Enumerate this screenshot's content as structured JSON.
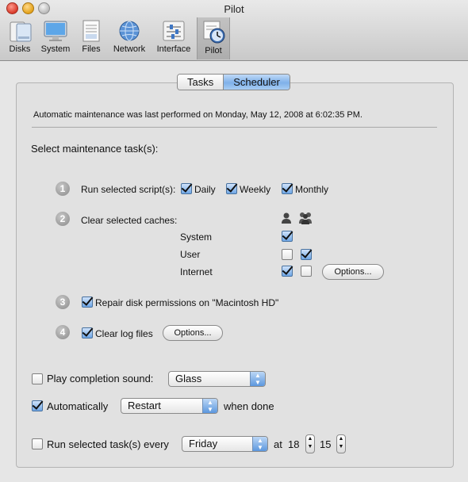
{
  "window": {
    "title": "Pilot"
  },
  "toolbar": {
    "items": [
      {
        "label": "Disks",
        "icon": "disks-icon"
      },
      {
        "label": "System",
        "icon": "system-display-icon"
      },
      {
        "label": "Files",
        "icon": "files-icon"
      },
      {
        "label": "Network",
        "icon": "network-globe-icon"
      },
      {
        "label": "Interface",
        "icon": "interface-sliders-icon"
      },
      {
        "label": "Pilot",
        "icon": "pilot-schedule-icon",
        "selected": true
      }
    ]
  },
  "tabs": [
    {
      "label": "Tasks",
      "active": false
    },
    {
      "label": "Scheduler",
      "active": true
    }
  ],
  "status_text": "Automatic maintenance was last performed on Monday, May 12, 2008 at 6:02:35 PM.",
  "section_title": "Select maintenance task(s):",
  "tasks": {
    "t1": {
      "number": "1",
      "label": "Run selected script(s):",
      "daily": {
        "label": "Daily",
        "checked": true
      },
      "weekly": {
        "label": "Weekly",
        "checked": true
      },
      "monthly": {
        "label": "Monthly",
        "checked": true
      }
    },
    "t2": {
      "number": "2",
      "label": "Clear selected caches:",
      "col_icons": [
        "single-user-icon",
        "group-users-icon"
      ],
      "system": {
        "label": "System",
        "user_checked": true
      },
      "user": {
        "label": "User",
        "user_checked": false,
        "group_checked": true
      },
      "internet": {
        "label": "Internet",
        "user_checked": true,
        "group_checked": false
      },
      "options_label": "Options..."
    },
    "t3": {
      "number": "3",
      "label": "Repair disk permissions on \"Macintosh HD\"",
      "checked": true
    },
    "t4": {
      "number": "4",
      "label": "Clear log files",
      "checked": true,
      "options_label": "Options..."
    }
  },
  "sound": {
    "label": "Play completion sound:",
    "checked": false,
    "value": "Glass"
  },
  "auto": {
    "label": "Automatically",
    "checked": true,
    "value": "Restart",
    "suffix": "when done"
  },
  "schedule": {
    "label": "Run selected task(s) every",
    "checked": false,
    "day": "Friday",
    "at_label": "at",
    "hour": "18",
    "minute": "15"
  }
}
